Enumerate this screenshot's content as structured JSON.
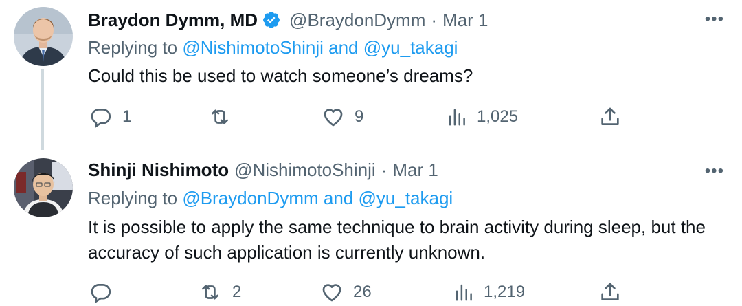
{
  "tweets": [
    {
      "name": "Braydon Dymm, MD",
      "handle": "@BraydonDymm",
      "dot": "·",
      "date": "Mar 1",
      "replying_prefix": "Replying to",
      "mention1": "@NishimotoShinji",
      "and": "and",
      "mention2": "@yu_takagi",
      "text": "Could this be used to watch someone’s dreams?",
      "more": "•••",
      "verified": true,
      "replies": "1",
      "retweets": "",
      "likes": "9",
      "views": "1,025"
    },
    {
      "name": "Shinji Nishimoto",
      "handle": "@NishimotoShinji",
      "dot": "·",
      "date": "Mar 1",
      "replying_prefix": "Replying to",
      "mention1": "@BraydonDymm",
      "and": "and",
      "mention2": "@yu_takagi",
      "text": "It is possible to apply the same technique to brain activity during sleep, but the accuracy of such application is currently unknown.",
      "more": "•••",
      "verified": false,
      "replies": "",
      "retweets": "2",
      "likes": "26",
      "views": "1,219"
    }
  ],
  "icons": {
    "reply": "reply-icon",
    "retweet": "retweet-icon",
    "like": "heart-icon",
    "views": "views-icon",
    "share": "share-icon",
    "more": "more-icon",
    "verified": "verified-badge-icon"
  },
  "colors": {
    "text": "#0f1419",
    "secondary": "#536471",
    "link": "#1d9bf0",
    "thread_line": "#cfd9de"
  }
}
